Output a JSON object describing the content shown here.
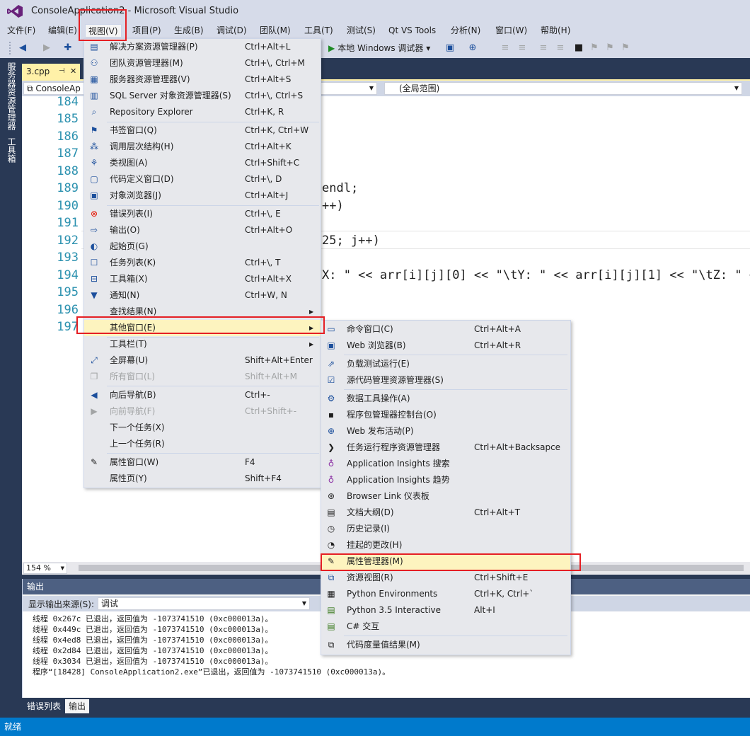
{
  "window": {
    "title": "ConsoleApplication2 - Microsoft Visual Studio"
  },
  "menubar": {
    "items": [
      "文件(F)",
      "编辑(E)",
      "视图(V)",
      "项目(P)",
      "生成(B)",
      "调试(D)",
      "团队(M)",
      "工具(T)",
      "测试(S)",
      "Qt VS Tools",
      "分析(N)",
      "窗口(W)",
      "帮助(H)"
    ]
  },
  "toolbar": {
    "run_label": "本地 Windows 调试器"
  },
  "left_tabs": [
    "服务器资源管理器",
    "工具箱"
  ],
  "document": {
    "tab_label": "3.cpp",
    "nav_project": "ConsoleAp",
    "nav_scope": "(全局范围)"
  },
  "editor": {
    "line_numbers": [
      "184",
      "185",
      "186",
      "187",
      "188",
      "189",
      "190",
      "191",
      "192",
      "193",
      "194",
      "195",
      "196",
      "197"
    ],
    "visible_fragments": {
      "l189": "endl;",
      "l190": "++)",
      "l192": "25; j++)",
      "l194": "X: \" << arr[i][j][0] << \"\\tY: \" << arr[i][j][1] << \"\\tZ: \" <<"
    }
  },
  "zoom": {
    "value": "154 %"
  },
  "output": {
    "title": "输出",
    "source_label": "显示输出来源(S):",
    "source_value": "调试",
    "lines": [
      "线程 0x267c 已退出，返回值为 -1073741510 (0xc000013a)。",
      "线程 0x449c 已退出，返回值为 -1073741510 (0xc000013a)。",
      "线程 0x4ed8 已退出，返回值为 -1073741510 (0xc000013a)。",
      "线程 0x2d84 已退出，返回值为 -1073741510 (0xc000013a)。",
      "线程 0x3034 已退出，返回值为 -1073741510 (0xc000013a)。",
      "程序“[18428] ConsoleApplication2.exe”已退出，返回值为 -1073741510 (0xc000013a)。"
    ]
  },
  "bottom_tabs": [
    "错误列表",
    "输出"
  ],
  "status": {
    "text": "就绪"
  },
  "view_menu": {
    "items": [
      {
        "label": "解决方案资源管理器(P)",
        "shortcut": "Ctrl+Alt+L",
        "icon": "solution-explorer-icon"
      },
      {
        "label": "团队资源管理器(M)",
        "shortcut": "Ctrl+\\, Ctrl+M",
        "icon": "team-explorer-icon"
      },
      {
        "label": "服务器资源管理器(V)",
        "shortcut": "Ctrl+Alt+S",
        "icon": "server-explorer-icon"
      },
      {
        "label": "SQL Server 对象资源管理器(S)",
        "shortcut": "Ctrl+\\, Ctrl+S",
        "icon": "sql-server-icon"
      },
      {
        "label": "Repository Explorer",
        "shortcut": "Ctrl+K, R",
        "icon": "repository-icon"
      },
      {
        "label": "书签窗口(Q)",
        "shortcut": "Ctrl+K, Ctrl+W",
        "icon": "bookmark-icon"
      },
      {
        "label": "调用层次结构(H)",
        "shortcut": "Ctrl+Alt+K",
        "icon": "call-hierarchy-icon"
      },
      {
        "label": "类视图(A)",
        "shortcut": "Ctrl+Shift+C",
        "icon": "class-view-icon"
      },
      {
        "label": "代码定义窗口(D)",
        "shortcut": "Ctrl+\\, D",
        "icon": "code-definition-icon"
      },
      {
        "label": "对象浏览器(J)",
        "shortcut": "Ctrl+Alt+J",
        "icon": "object-browser-icon"
      },
      {
        "label": "错误列表(I)",
        "shortcut": "Ctrl+\\, E",
        "icon": "error-list-icon"
      },
      {
        "label": "输出(O)",
        "shortcut": "Ctrl+Alt+O",
        "icon": "output-icon"
      },
      {
        "label": "起始页(G)",
        "shortcut": "",
        "icon": "start-page-icon"
      },
      {
        "label": "任务列表(K)",
        "shortcut": "Ctrl+\\, T",
        "icon": "task-list-icon"
      },
      {
        "label": "工具箱(X)",
        "shortcut": "Ctrl+Alt+X",
        "icon": "toolbox-icon"
      },
      {
        "label": "通知(N)",
        "shortcut": "Ctrl+W, N",
        "icon": "notification-icon"
      },
      {
        "label": "查找结果(N)",
        "shortcut": "",
        "icon": ""
      },
      {
        "label": "其他窗口(E)",
        "shortcut": "",
        "icon": ""
      },
      {
        "label": "工具栏(T)",
        "shortcut": "",
        "icon": ""
      },
      {
        "label": "全屏幕(U)",
        "shortcut": "Shift+Alt+Enter",
        "icon": "fullscreen-icon"
      },
      {
        "label": "所有窗口(L)",
        "shortcut": "Shift+Alt+M",
        "icon": "all-windows-icon"
      },
      {
        "label": "向后导航(B)",
        "shortcut": "Ctrl+-",
        "icon": "navigate-back-icon"
      },
      {
        "label": "向前导航(F)",
        "shortcut": "Ctrl+Shift+-",
        "icon": "navigate-forward-icon"
      },
      {
        "label": "下一个任务(X)",
        "shortcut": "",
        "icon": ""
      },
      {
        "label": "上一个任务(R)",
        "shortcut": "",
        "icon": ""
      },
      {
        "label": "属性窗口(W)",
        "shortcut": "F4",
        "icon": "wrench-icon"
      },
      {
        "label": "属性页(Y)",
        "shortcut": "Shift+F4",
        "icon": ""
      }
    ]
  },
  "other_windows_menu": {
    "items": [
      {
        "label": "命令窗口(C)",
        "shortcut": "Ctrl+Alt+A",
        "icon": "command-window-icon"
      },
      {
        "label": "Web 浏览器(B)",
        "shortcut": "Ctrl+Alt+R",
        "icon": "web-browser-icon"
      },
      {
        "label": "负载测试运行(E)",
        "shortcut": "",
        "icon": "load-test-icon"
      },
      {
        "label": "源代码管理资源管理器(S)",
        "shortcut": "",
        "icon": "source-control-icon"
      },
      {
        "label": "数据工具操作(A)",
        "shortcut": "",
        "icon": "data-tools-icon"
      },
      {
        "label": "程序包管理器控制台(O)",
        "shortcut": "",
        "icon": "package-console-icon"
      },
      {
        "label": "Web 发布活动(P)",
        "shortcut": "",
        "icon": "web-publish-icon"
      },
      {
        "label": "任务运行程序资源管理器",
        "shortcut": "Ctrl+Alt+Backsapce",
        "icon": "task-runner-icon"
      },
      {
        "label": "Application Insights 搜索",
        "shortcut": "",
        "icon": "insights-search-icon"
      },
      {
        "label": "Application Insights 趋势",
        "shortcut": "",
        "icon": "insights-trends-icon"
      },
      {
        "label": "Browser Link 仪表板",
        "shortcut": "",
        "icon": "browser-link-icon"
      },
      {
        "label": "文档大纲(D)",
        "shortcut": "Ctrl+Alt+T",
        "icon": "document-outline-icon"
      },
      {
        "label": "历史记录(I)",
        "shortcut": "",
        "icon": "history-icon"
      },
      {
        "label": "挂起的更改(H)",
        "shortcut": "",
        "icon": "pending-changes-icon"
      },
      {
        "label": "属性管理器(M)",
        "shortcut": "",
        "icon": "wrench-icon"
      },
      {
        "label": "资源视图(R)",
        "shortcut": "Ctrl+Shift+E",
        "icon": "resource-view-icon"
      },
      {
        "label": "Python Environments",
        "shortcut": "Ctrl+K, Ctrl+`",
        "icon": "python-env-icon"
      },
      {
        "label": "Python 3.5 Interactive",
        "shortcut": "Alt+I",
        "icon": "python-interactive-icon"
      },
      {
        "label": "C# 交互",
        "shortcut": "",
        "icon": "csharp-interactive-icon"
      },
      {
        "label": "代码度量值结果(M)",
        "shortcut": "",
        "icon": "code-metrics-icon"
      }
    ]
  },
  "colors": {
    "chrome": "#d6dbe9",
    "dark": "#293955",
    "status": "#007acc",
    "menu_bg": "#e7e8ec",
    "highlight": "#fdf4bf",
    "annotation_red": "#e51f24"
  }
}
